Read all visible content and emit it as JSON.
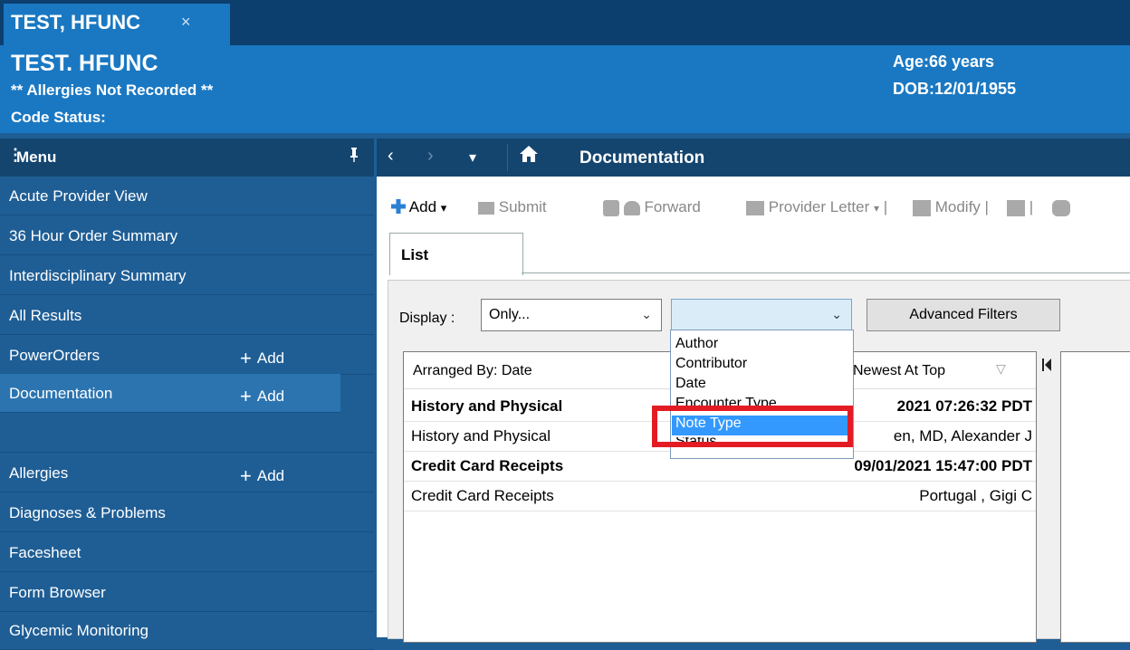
{
  "tab": {
    "patient_name": "TEST, HFUNC",
    "close": "×"
  },
  "banner": {
    "name": "TEST. HFUNC",
    "allergies": "** Allergies Not Recorded **",
    "code_status": "Code Status:",
    "age": "Age:66 years",
    "dob": "DOB:12/01/1955"
  },
  "menu": {
    "title": "Menu",
    "pin": "⊼",
    "items": [
      {
        "label": "Acute Provider View"
      },
      {
        "label": "36 Hour Order Summary"
      },
      {
        "label": "Interdisciplinary Summary"
      },
      {
        "label": "All Results"
      },
      {
        "label": "PowerOrders",
        "add": "Add"
      },
      {
        "label": "Documentation",
        "add": "Add"
      },
      {
        "label": ""
      },
      {
        "label": "Allergies",
        "add": "Add"
      },
      {
        "label": "Diagnoses & Problems"
      },
      {
        "label": "Facesheet"
      },
      {
        "label": "Form Browser"
      },
      {
        "label": "Glycemic Monitoring"
      }
    ]
  },
  "nav": {
    "back": "‹",
    "forward": "›",
    "dropdown": "▾",
    "home": "⌂",
    "title": "Documentation"
  },
  "toolbar": {
    "add": "Add",
    "submit": "Submit",
    "forward": "Forward",
    "provider_letter": "Provider Letter",
    "modify": "Modify"
  },
  "list_tab": "List",
  "filters": {
    "display_label": "Display :",
    "display_value": "Only...",
    "second_value": "",
    "advanced": "Advanced Filters"
  },
  "list": {
    "arranged_by": "Arranged By: Date",
    "sort": "Newest At Top",
    "rows": [
      {
        "left": "History and Physical",
        "right": "2021 07:26:32 PDT",
        "bold": true
      },
      {
        "left": "History and Physical",
        "right": "en, MD, Alexander J",
        "bold": false
      },
      {
        "left": "Credit Card Receipts",
        "right": "09/01/2021 15:47:00 PDT",
        "bold": true
      },
      {
        "left": "Credit Card Receipts",
        "right": "Portugal , Gigi C",
        "bold": false
      }
    ]
  },
  "dropdown": {
    "options": [
      "Author",
      "Contributor",
      "Date",
      "Encounter Type",
      "Note Type",
      "Status"
    ],
    "selected": "Note Type"
  },
  "colors": {
    "banner": "#1a78c2",
    "sidebar": "#1f5e95",
    "highlight": "#e31c24",
    "selection": "#3399ff"
  }
}
